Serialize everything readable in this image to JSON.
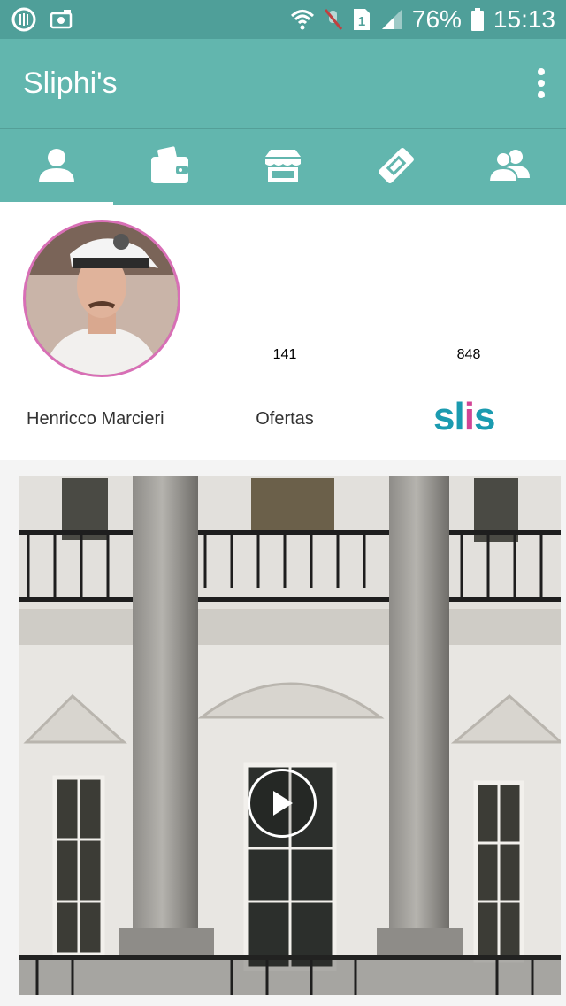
{
  "status_bar": {
    "battery": "76%",
    "time": "15:13",
    "sim_label": "1"
  },
  "app_bar": {
    "title": "Sliphi's",
    "overflow_menu_icon": "more-vert-icon"
  },
  "tabs": [
    {
      "name": "profile",
      "icon": "person-icon",
      "active": true
    },
    {
      "name": "wallet",
      "icon": "wallet-icon",
      "active": false
    },
    {
      "name": "store",
      "icon": "store-icon",
      "active": false
    },
    {
      "name": "tickets",
      "icon": "ticket-icon",
      "active": false
    },
    {
      "name": "friends",
      "icon": "group-icon",
      "active": false
    }
  ],
  "profile": {
    "name": "Henricco Marcieri",
    "offers_count": "141",
    "offers_label": "Ofertas",
    "slis_count": "848",
    "slis_logo_text": "slis"
  },
  "video": {
    "play_icon": "play-icon"
  },
  "colors": {
    "primary": "#62b6ae",
    "status_bar": "#4f9f99",
    "avatar_border": "#d86fb6",
    "slis_blue": "#1b9bb0",
    "slis_pink": "#d24596"
  }
}
